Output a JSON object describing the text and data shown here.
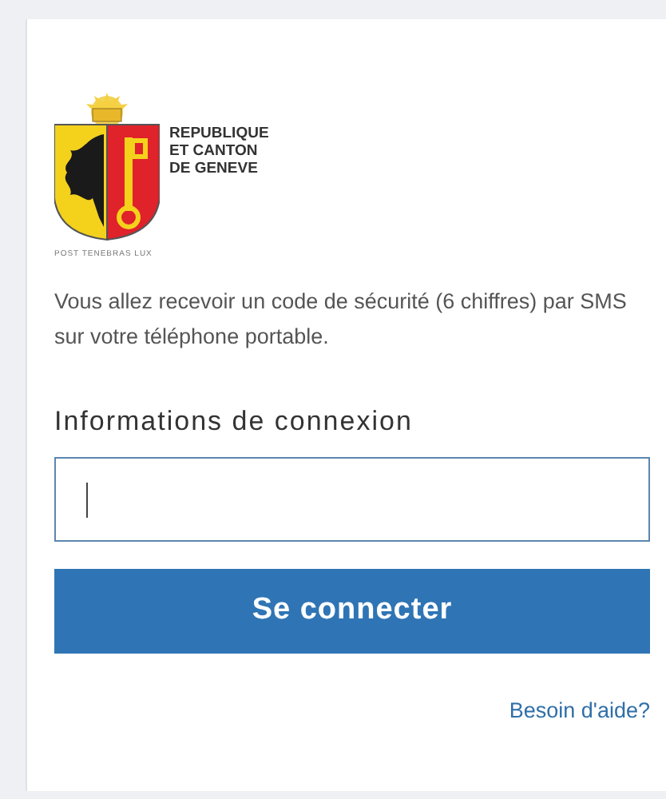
{
  "logo": {
    "lines": [
      "REPUBLIQUE",
      "ET CANTON",
      "DE GENEVE"
    ],
    "motto": "POST TENEBRAS LUX"
  },
  "message": "Vous allez recevoir un code de sécurité (6 chiffres) par SMS sur votre téléphone portable.",
  "login_label": "Informations de connexion",
  "submit_button": "Se connecter",
  "help_link": "Besoin d'aide?"
}
